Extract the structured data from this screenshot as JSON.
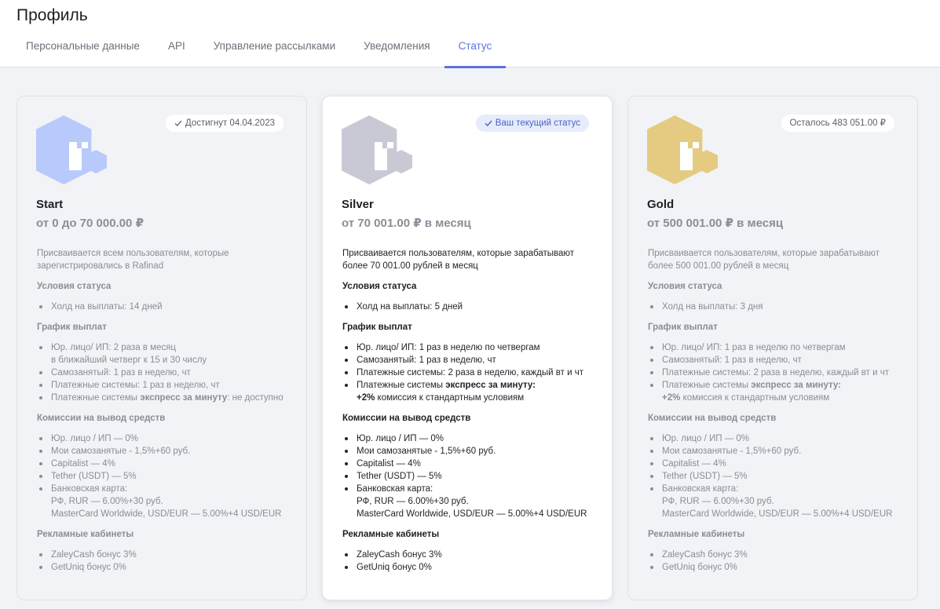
{
  "page": {
    "title": "Профиль"
  },
  "tabs": [
    {
      "label": "Персональные данные"
    },
    {
      "label": "API"
    },
    {
      "label": "Управление рассылками"
    },
    {
      "label": "Уведомления"
    },
    {
      "label": "Статус",
      "active": true
    }
  ],
  "colors": {
    "accent": "#5b74e0",
    "start": "#b8c9fb",
    "silver": "#c9c9d6",
    "gold": "#e5cb82"
  },
  "cards": [
    {
      "badge": "Достигнут 04.04.2023",
      "name": "Start",
      "range": "от 0 до 70 000.00 ₽",
      "description": "Присваивается всем пользователям, которые зарегистрировались в Rafinad",
      "conditions_title": "Условия статуса",
      "conditions": [
        "Холд на выплаты: 14 дней"
      ],
      "schedule_title": "График выплат",
      "schedule": {
        "s1_line1": "Юр. лицо/ ИП: 2 раза в месяц",
        "s1_line2": "в ближайший четверг к 15 и 30 числу",
        "s2": "Самозанятый: 1 раз в неделю, чт",
        "s3": "Платежные системы: 1 раз в неделю, чт",
        "s4_pre": "Платежные системы ",
        "s4_bold": "экспресс за минуту",
        "s4_post": ": не доступно"
      },
      "fees_title": "Комиссии на вывод средств",
      "fees": {
        "f1": "Юр. лицо / ИП — 0%",
        "f2": "Мои самозанятые - 1,5%+60 руб.",
        "f3": "Capitalist — 4%",
        "f4": "Tether (USDT) — 5%",
        "f5_line1": "Банковская карта:",
        "f5_line2": "РФ, RUR — 6.00%+30 руб.",
        "f5_line3": "MasterCard Worldwide, USD/EUR — 5.00%+4 USD/EUR"
      },
      "ads_title": "Рекламные кабинеты",
      "ads": [
        "ZaleyCash бонус 3%",
        "GetUniq бонус 0%"
      ]
    },
    {
      "badge": "Ваш текущий статус",
      "name": "Silver",
      "range": "от 70 001.00 ₽ в месяц",
      "description": "Присваивается пользователям, которые зарабатывают более 70 001.00 рублей в месяц",
      "conditions_title": "Условия статуса",
      "conditions": [
        "Холд на выплаты: 5 дней"
      ],
      "schedule_title": "График выплат",
      "schedule": {
        "s1": "Юр. лицо/ ИП: 1 раз в неделю по четвергам",
        "s2": "Самозанятый: 1 раз в неделю, чт",
        "s3": "Платежные системы: 2 раза в неделю, каждый вт и чт",
        "s4_pre": "Платежные системы ",
        "s4_bold": "экспресс за минуту:",
        "s4_bold2": "+2%",
        "s4_post": " комиссия к стандартным условиям"
      },
      "fees_title": "Комиссии на вывод средств",
      "fees": {
        "f1": "Юр. лицо / ИП — 0%",
        "f2": "Мои самозанятые - 1,5%+60 руб.",
        "f3": "Capitalist — 4%",
        "f4": "Tether (USDT) — 5%",
        "f5_line1": "Банковская карта:",
        "f5_line2": "РФ, RUR — 6.00%+30 руб.",
        "f5_line3": "MasterCard Worldwide, USD/EUR — 5.00%+4 USD/EUR"
      },
      "ads_title": "Рекламные кабинеты",
      "ads": [
        "ZaleyCash бонус 3%",
        "GetUniq бонус 0%"
      ]
    },
    {
      "badge": "Осталось 483 051.00 ₽",
      "name": "Gold",
      "range": "от 500 001.00 ₽ в месяц",
      "description": "Присваивается пользователям, которые зарабатывают более 500 001.00 рублей в месяц",
      "conditions_title": "Условия статуса",
      "conditions": [
        "Холд на выплаты: 3 дня"
      ],
      "schedule_title": "График выплат",
      "schedule": {
        "s1": "Юр. лицо/ ИП: 1 раз в неделю по четвергам",
        "s2": "Самозанятый: 1 раз в неделю, чт",
        "s3": "Платежные системы: 2 раза в неделю, каждый вт и чт",
        "s4_pre": "Платежные системы ",
        "s4_bold": "экспресс за минуту:",
        "s4_bold2": "+2%",
        "s4_post": " комиссия к стандартным условиям"
      },
      "fees_title": "Комиссии на вывод средств",
      "fees": {
        "f1": "Юр. лицо / ИП — 0%",
        "f2": "Мои самозанятые - 1,5%+60 руб.",
        "f3": "Capitalist — 4%",
        "f4": "Tether (USDT) — 5%",
        "f5_line1": "Банковская карта:",
        "f5_line2": "РФ, RUR — 6.00%+30 руб.",
        "f5_line3": "MasterCard Worldwide, USD/EUR — 5.00%+4 USD/EUR"
      },
      "ads_title": "Рекламные кабинеты",
      "ads": [
        "ZaleyCash бонус 3%",
        "GetUniq бонус 0%"
      ]
    }
  ]
}
